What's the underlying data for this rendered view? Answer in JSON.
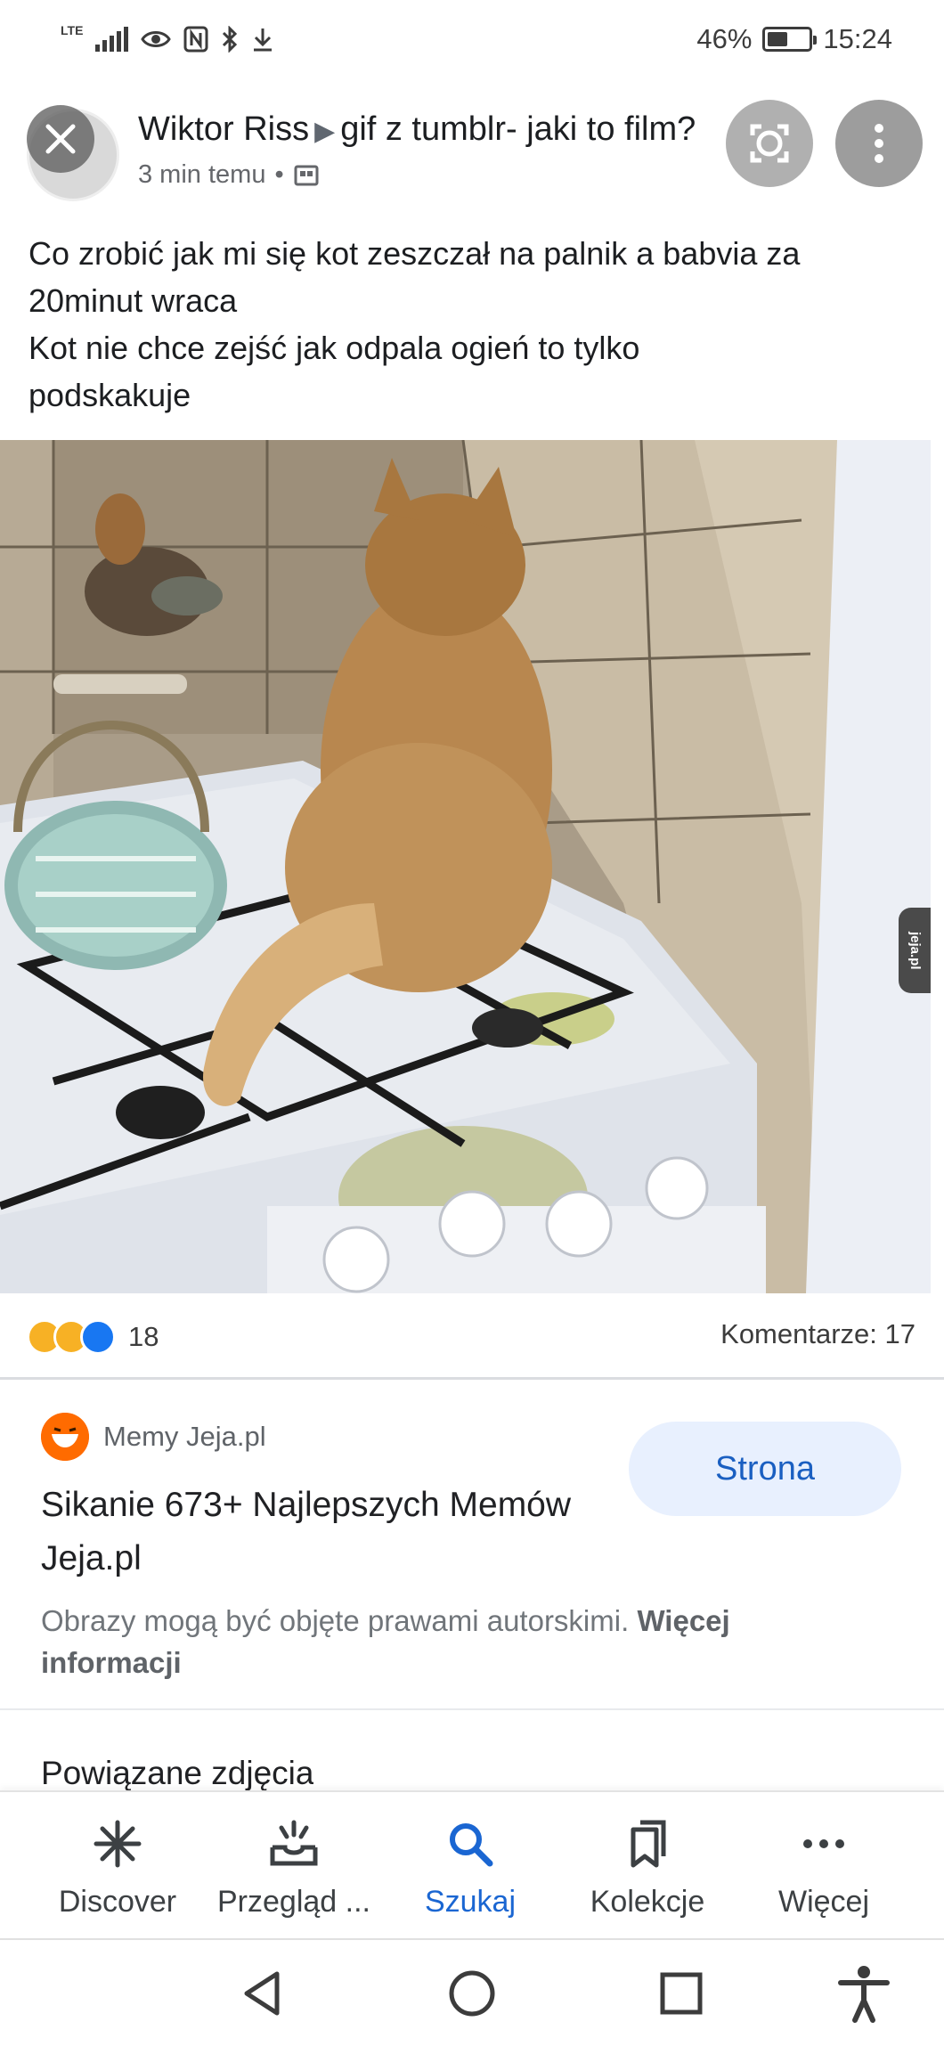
{
  "status_bar": {
    "network": "LTE",
    "battery": "46%",
    "time": "15:24"
  },
  "post": {
    "author": "Wiktor Riss",
    "group": "gif z tumblr- jaki to film?",
    "time_ago": "3 min temu",
    "separator": "•",
    "text_lines": [
      "Co zrobić jak mi się kot zeszczał na palnik a babvia za",
      "20minut wraca",
      "Kot nie chce zejść jak odpala ogień to tylko",
      "podskakuje"
    ],
    "watermark": "jeja.pl",
    "reaction_count": "18",
    "comments": "Komentarze: 17"
  },
  "source": {
    "name": "Memy Jeja.pl",
    "title": "Sikanie 673+ Najlepszych Memów Jeja.pl",
    "button": "Strona",
    "copyright_text": "Obrazy mogą być objęte prawami autorskimi.",
    "copyright_link": "Więcej informacji"
  },
  "related": {
    "heading": "Powiązane zdjęcia"
  },
  "bottom_nav": {
    "items": [
      {
        "label": "Discover",
        "icon": "asterisk-icon"
      },
      {
        "label": "Przegląd ...",
        "icon": "inbox-icon"
      },
      {
        "label": "Szukaj",
        "icon": "search-icon"
      },
      {
        "label": "Kolekcje",
        "icon": "bookmarks-icon"
      },
      {
        "label": "Więcej",
        "icon": "more-icon"
      }
    ],
    "active_color": "#1a66d2"
  }
}
